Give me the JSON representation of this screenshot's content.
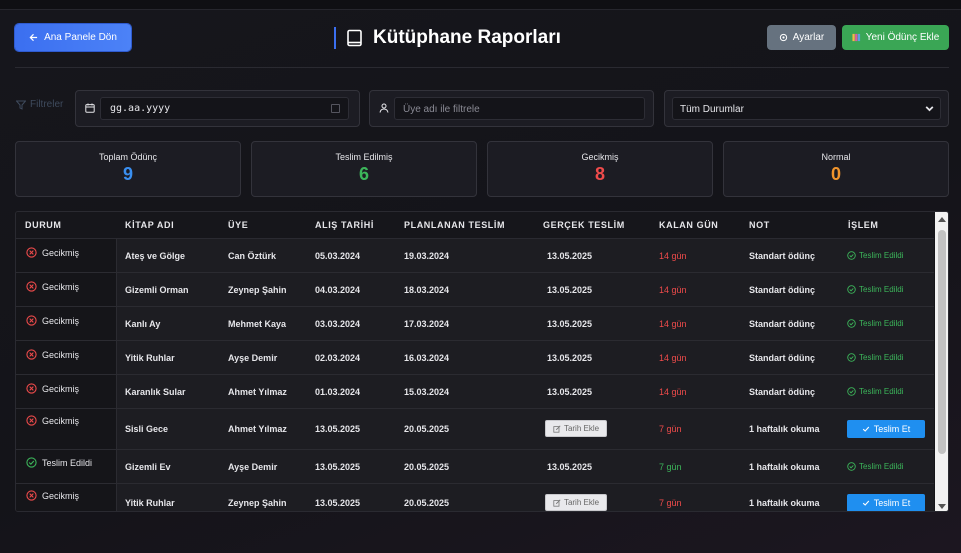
{
  "header": {
    "back_label": "Ana Panele Dön",
    "title": "Kütüphane Raporları",
    "settings_label": "Ayarlar",
    "new_loan_label": "Yeni Ödünç Ekle"
  },
  "filters": {
    "label": "Filtreler",
    "date_value": "gg.aa.yyyy",
    "member_placeholder": "Üye adı ile filtrele",
    "status_selected": "Tüm Durumlar"
  },
  "stats": {
    "total_label": "Toplam Ödünç",
    "total_value": "9",
    "returned_label": "Teslim Edilmiş",
    "returned_value": "6",
    "late_label": "Gecikmiş",
    "late_value": "8",
    "normal_label": "Normal",
    "normal_value": "0"
  },
  "colors": {
    "accent_blue": "#3b6ff0",
    "success_green": "#3aa655",
    "late_red": "#ef4b4b",
    "normal_orange": "#f0942c",
    "total_blue": "#3a8ff0"
  },
  "table": {
    "headers": {
      "status": "DURUM",
      "book": "KİTAP ADI",
      "member": "ÜYE",
      "borrow_date": "ALIŞ TARİHİ",
      "planned_return": "PLANLANAN TESLİM",
      "actual_return": "GERÇEK TESLİM",
      "days_left": "KALAN GÜN",
      "note": "NOT",
      "action": "İŞLEM"
    },
    "rows": [
      {
        "status": "Gecikmiş",
        "book": "Ateş ve Gölge",
        "member": "Can Öztürk",
        "borrow": "05.03.2024",
        "planned": "19.03.2024",
        "actual": "13.05.2025",
        "days": "14 gün",
        "note": "Standart ödünç",
        "action": "Teslim Edildi"
      },
      {
        "status": "Gecikmiş",
        "book": "Gizemli Orman",
        "member": "Zeynep Şahin",
        "borrow": "04.03.2024",
        "planned": "18.03.2024",
        "actual": "13.05.2025",
        "days": "14 gün",
        "note": "Standart ödünç",
        "action": "Teslim Edildi"
      },
      {
        "status": "Gecikmiş",
        "book": "Kanlı Ay",
        "member": "Mehmet Kaya",
        "borrow": "03.03.2024",
        "planned": "17.03.2024",
        "actual": "13.05.2025",
        "days": "14 gün",
        "note": "Standart ödünç",
        "action": "Teslim Edildi"
      },
      {
        "status": "Gecikmiş",
        "book": "Yitik Ruhlar",
        "member": "Ayşe Demir",
        "borrow": "02.03.2024",
        "planned": "16.03.2024",
        "actual": "13.05.2025",
        "days": "14 gün",
        "note": "Standart ödünç",
        "action": "Teslim Edildi"
      },
      {
        "status": "Gecikmiş",
        "book": "Karanlık Sular",
        "member": "Ahmet Yılmaz",
        "borrow": "01.03.2024",
        "planned": "15.03.2024",
        "actual": "13.05.2025",
        "days": "14 gün",
        "note": "Standart ödünç",
        "action": "Teslim Edildi"
      },
      {
        "status": "Gecikmiş",
        "book": "Sisli Gece",
        "member": "Ahmet Yılmaz",
        "borrow": "13.05.2025",
        "planned": "20.05.2025",
        "actual_button": "Tarih Ekle",
        "days": "7 gün",
        "note": "1 haftalık okuma",
        "action_button": "Teslim Et"
      },
      {
        "status": "Teslim Edildi",
        "book": "Gizemli Ev",
        "member": "Ayşe Demir",
        "borrow": "13.05.2025",
        "planned": "20.05.2025",
        "actual": "13.05.2025",
        "days": "7 gün",
        "note": "1 haftalık okuma",
        "action": "Teslim Edildi"
      },
      {
        "status": "Gecikmiş",
        "book": "Yitik Ruhlar",
        "member": "Zeynep Şahin",
        "borrow": "13.05.2025",
        "planned": "20.05.2025",
        "actual_button": "Tarih Ekle",
        "days": "7 gün",
        "note": "1 haftalık okuma",
        "action_button": "Teslim Et"
      }
    ]
  }
}
